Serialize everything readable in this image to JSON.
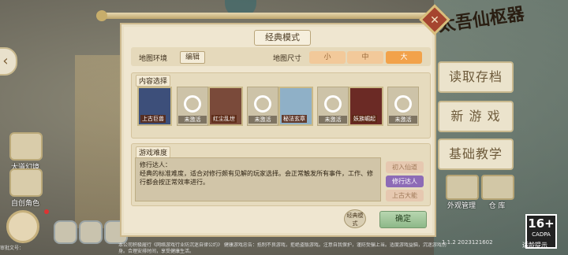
{
  "game": {
    "logo_text": "太吾仙枢器"
  },
  "side_buttons": [
    {
      "label": "大道幻境"
    },
    {
      "label": "自创角色"
    }
  ],
  "main_menu": [
    {
      "label": "读取存档"
    },
    {
      "label": "新 游 戏"
    },
    {
      "label": "基础教学"
    }
  ],
  "right_small": [
    {
      "label": "外观管理"
    },
    {
      "label": "仓 库"
    }
  ],
  "age_rating": {
    "num": "16+",
    "sub": "CADPA",
    "caption": "适龄提示"
  },
  "version": "1.1.2  2023121602",
  "dialog": {
    "title": "经典模式",
    "map_env_label": "地图环境",
    "edit_label": "编辑",
    "map_size_label": "地图尺寸",
    "map_sizes": [
      {
        "label": "小",
        "selected": false
      },
      {
        "label": "中",
        "selected": false
      },
      {
        "label": "大",
        "selected": true
      }
    ],
    "content_title": "内容选择",
    "cards": [
      {
        "caption": "上古巨兽",
        "color": "#3d4f7a",
        "state": "active"
      },
      {
        "caption": "未激活",
        "state": "inactive"
      },
      {
        "caption": "红尘乱世",
        "color": "#7a4a3a",
        "state": "active"
      },
      {
        "caption": "未激活",
        "state": "inactive"
      },
      {
        "caption": "秘法玄章",
        "color": "#8fb0c7",
        "state": "active"
      },
      {
        "caption": "未激活",
        "state": "inactive"
      },
      {
        "caption": "妖族崛起",
        "color": "#6b2a25",
        "state": "active"
      },
      {
        "caption": "未激活",
        "state": "inactive"
      }
    ],
    "difficulty_title": "游戏难度",
    "difficulty_name": "修行达人：",
    "difficulty_desc": "经典的标准难度，适合对修行颇有见解的玩家选择。会正常触发所有事件，工作、修行都会按正常效率进行。",
    "difficulty_options": [
      {
        "label": "初入仙道",
        "selected": false
      },
      {
        "label": "修行达人",
        "selected": true
      },
      {
        "label": "上古大能",
        "selected": false
      }
    ],
    "mode_seal": "经典模式",
    "confirm_label": "确定"
  },
  "footer": {
    "left": "审批文号：",
    "text": "本公司积极履行《网络游戏行业防沉迷自律公约》 健康游戏忠告：抵制不良游戏，拒绝盗版游戏。注意自我保护，谨防受骗上当。适度游戏益脑，沉迷游戏伤身。合理安排时间，享受健康生活。"
  },
  "colors": {
    "panel": "#efe6d0",
    "accent_orange": "#f2a24a",
    "accent_purple": "#8d6bb6",
    "confirm_green": "#8db888"
  }
}
